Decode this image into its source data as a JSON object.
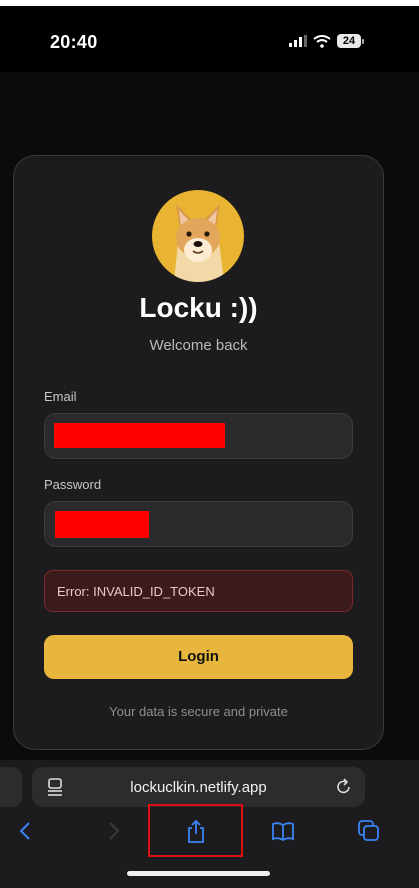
{
  "status_bar": {
    "time": "20:40",
    "battery": "24",
    "icons": [
      "signal-icon",
      "wifi-icon",
      "battery-icon"
    ]
  },
  "login_card": {
    "title": "Locku :))",
    "subtitle": "Welcome back",
    "email": {
      "label": "Email",
      "value": "[redacted]"
    },
    "password": {
      "label": "Password",
      "value": "[redacted]"
    },
    "error": "Error: INVALID_ID_TOKEN",
    "login_button": "Login",
    "footer": "Your data is secure and private"
  },
  "browser": {
    "url": "lockuclkin.netlify.app",
    "toolbar": [
      "back-icon",
      "forward-icon",
      "share-icon",
      "bookmarks-icon",
      "tabs-icon"
    ]
  },
  "colors": {
    "accent": "#e8b63d",
    "card_bg": "#1c1c1e",
    "error_bg": "#3a1a1a",
    "redaction": "#ff0000",
    "highlight": "#e01010"
  }
}
